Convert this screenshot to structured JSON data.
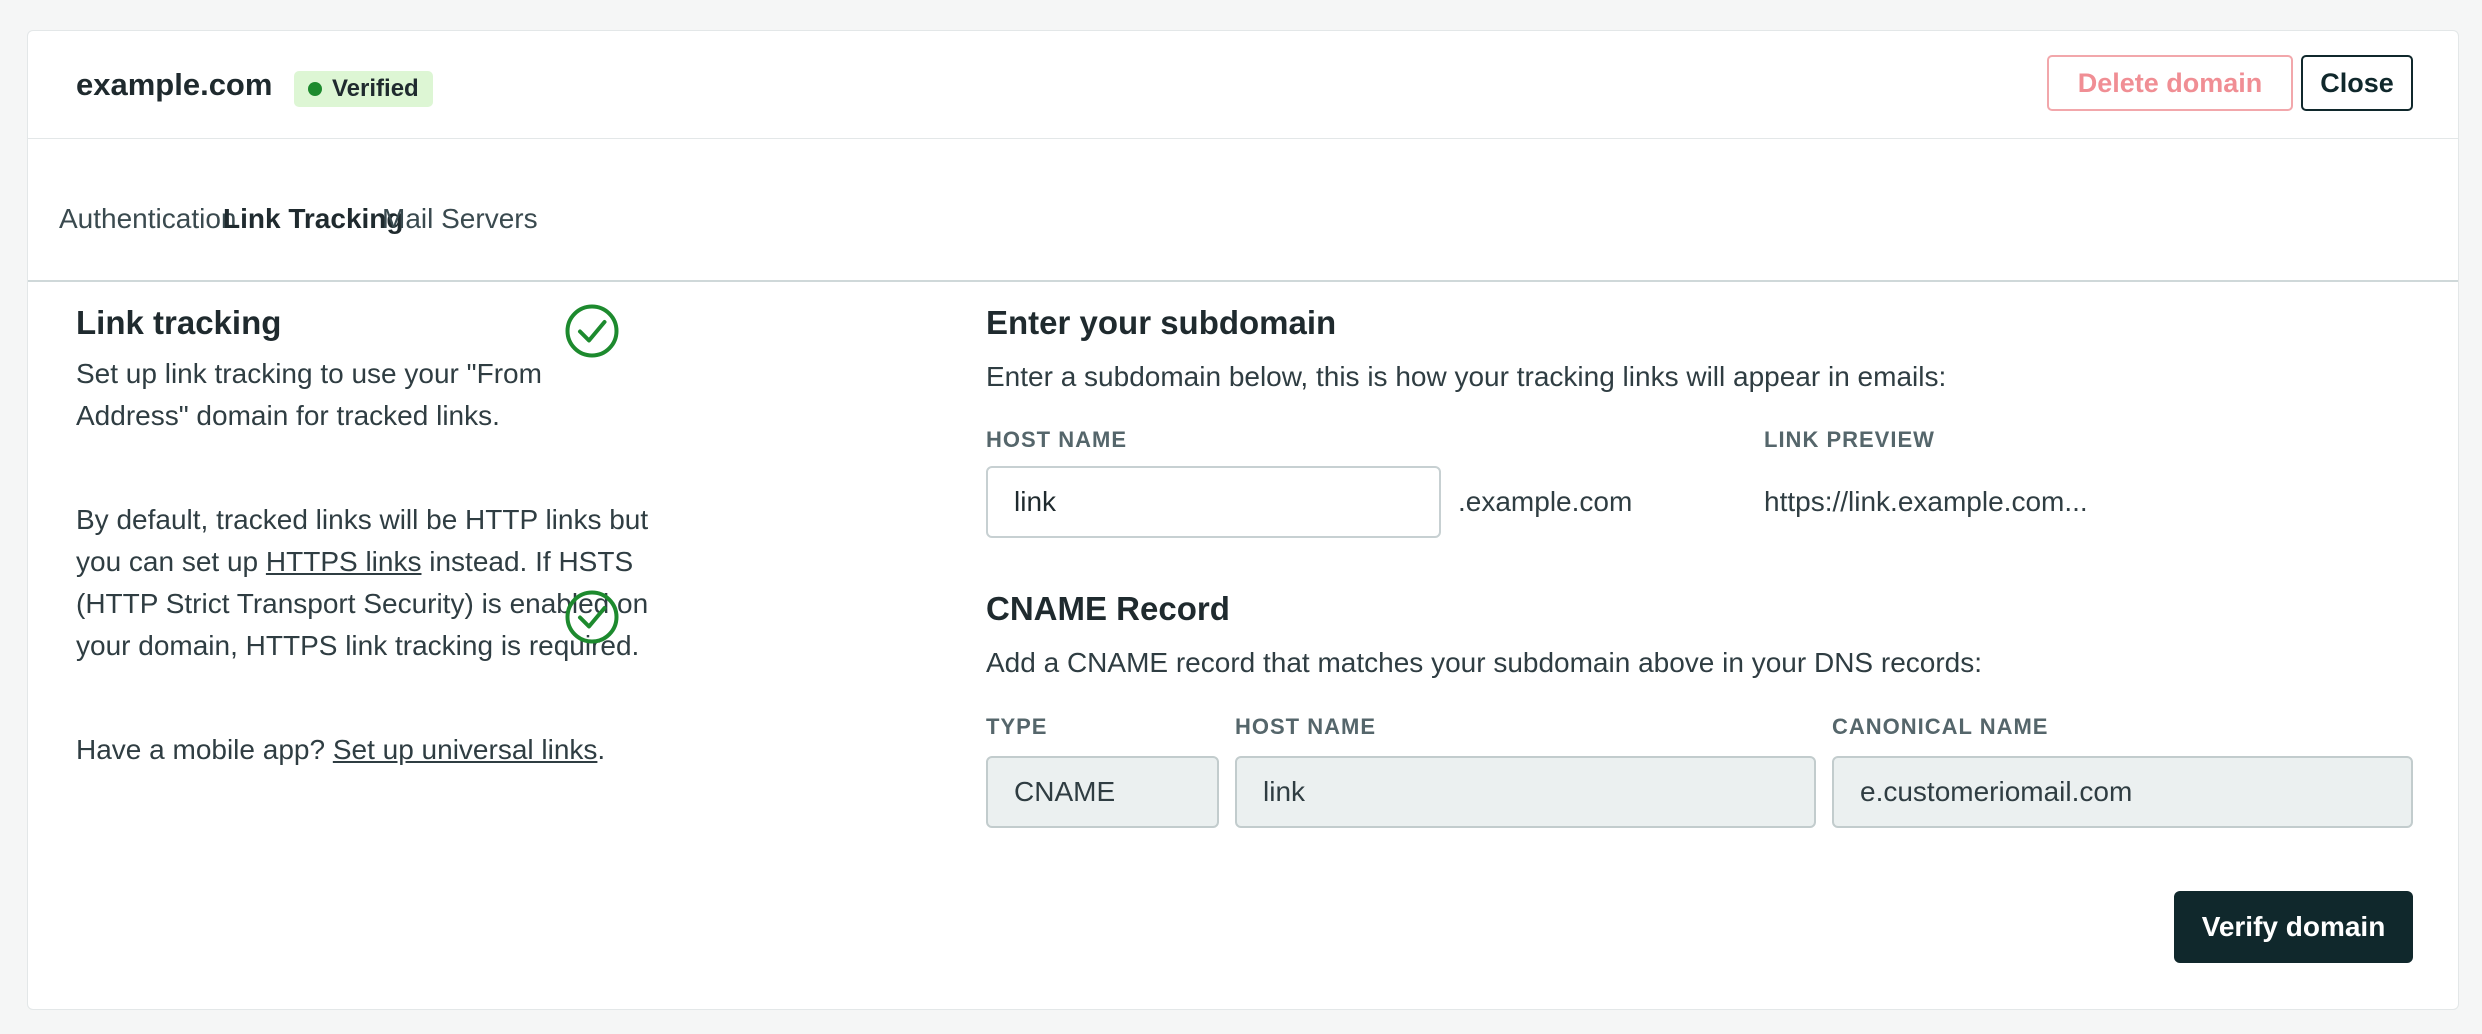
{
  "header": {
    "domain": "example.com",
    "status_badge": "Verified",
    "delete_label": "Delete domain",
    "close_label": "Close"
  },
  "tabs": [
    {
      "label": "Authentication",
      "active": false
    },
    {
      "label": "Link Tracking",
      "active": true
    },
    {
      "label": "Mail Servers",
      "active": false
    }
  ],
  "left": {
    "title": "Link tracking",
    "para1": "Set up link tracking to use your \"From Address\" domain for tracked links.",
    "para2_before": "By default, tracked links will be HTTP links but you can set up ",
    "para2_link": "HTTPS links",
    "para2_after": " instead. If HSTS (HTTP Strict Transport Security) is enabled on your domain, HTTPS link tracking is required.",
    "para3_before": "Have a mobile app? ",
    "para3_link": "Set up universal links",
    "para3_after": "."
  },
  "subdomain": {
    "title": "Enter your subdomain",
    "description": "Enter a subdomain below, this is how your tracking links will appear in emails:",
    "host_label": "HOST NAME",
    "host_value": "link",
    "suffix": ".example.com",
    "preview_label": "LINK PREVIEW",
    "preview_value": "https://link.example.com..."
  },
  "cname": {
    "title": "CNAME Record",
    "description": "Add a CNAME record that matches your subdomain above in your DNS records:",
    "type_label": "TYPE",
    "type_value": "CNAME",
    "host_label": "HOST NAME",
    "host_value": "link",
    "canonical_label": "CANONICAL NAME",
    "canonical_value": "e.customeriomail.com"
  },
  "actions": {
    "verify_label": "Verify domain"
  },
  "colors": {
    "accent": "#1a6fe0",
    "success": "#1d8a2e",
    "danger": "#f08e94",
    "primary_dark": "#10282c"
  },
  "icons": {
    "subdomain_status": "check-circle-icon",
    "cname_status": "check-circle-icon"
  }
}
